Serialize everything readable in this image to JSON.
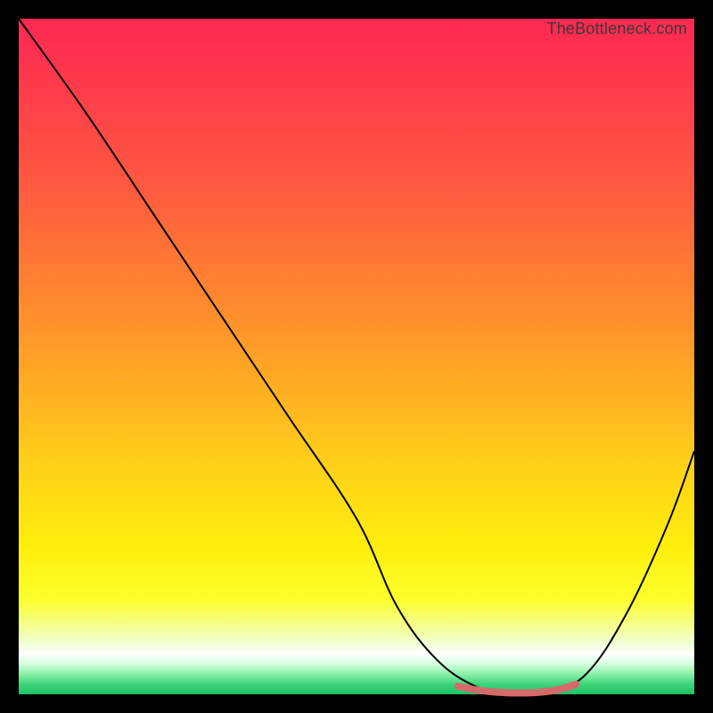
{
  "watermark": "TheBottleneck.com",
  "chart_data": {
    "type": "line",
    "title": "",
    "xlabel": "",
    "ylabel": "",
    "xlim": [
      0,
      100
    ],
    "ylim": [
      0,
      100
    ],
    "series": [
      {
        "name": "bottleneck-curve",
        "x": [
          0,
          10,
          20,
          30,
          40,
          50,
          56,
          62,
          68,
          73,
          78,
          84,
          90,
          96,
          100
        ],
        "y": [
          100,
          86,
          71,
          56,
          41,
          26,
          13,
          5,
          1,
          0,
          0,
          3,
          12,
          25,
          36
        ],
        "stroke": "#000000",
        "stroke_width": 2
      },
      {
        "name": "valley-highlight",
        "x": [
          65,
          68,
          71,
          74,
          77,
          80,
          82.5
        ],
        "y": [
          1.2,
          0.6,
          0.3,
          0.2,
          0.3,
          0.7,
          1.5
        ],
        "stroke": "#d56a6a",
        "stroke_width": 8
      }
    ],
    "grid": false
  }
}
